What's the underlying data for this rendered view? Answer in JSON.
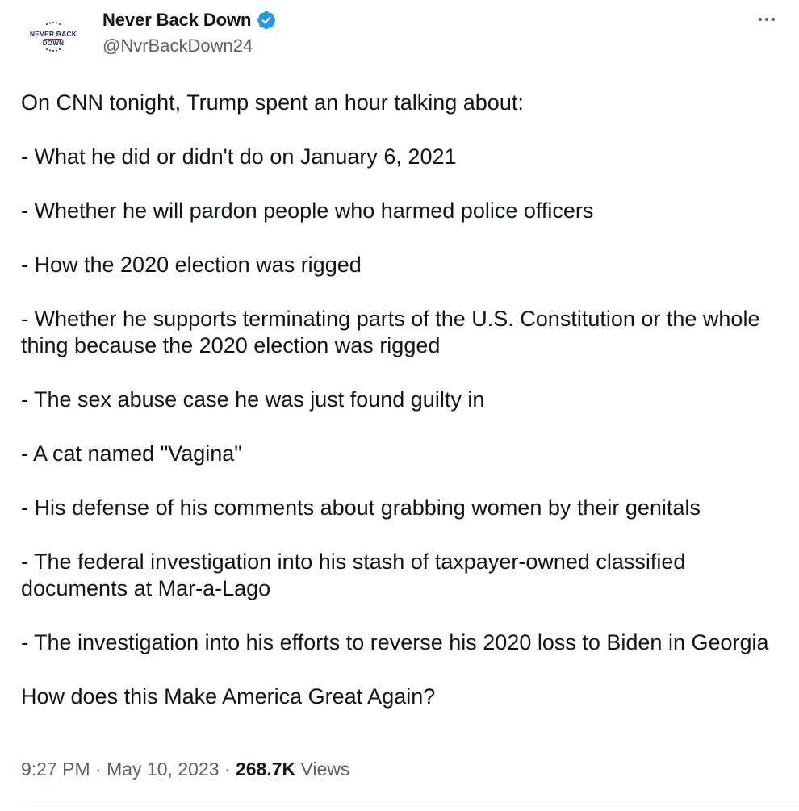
{
  "author": {
    "display_name": "Never Back Down",
    "handle": "@NvrBackDown24",
    "avatar_text": "NEVER BACK DOWN",
    "verified": true
  },
  "tweet": {
    "paragraphs": [
      "On CNN tonight, Trump spent an hour talking about:",
      "- What he did or didn't do on January 6, 2021",
      "- Whether he will pardon people who harmed police officers",
      "- How the 2020 election was rigged",
      "- Whether he supports terminating parts of the U.S. Constitution or the whole thing because the 2020 election was rigged",
      "- The sex abuse case he was just found guilty in",
      "- A cat named \"Vagina\"",
      "- His defense of his comments about grabbing women by their genitals",
      "- The federal investigation into his stash of taxpayer-owned classified documents at Mar-a-Lago",
      "- The investigation into his efforts to reverse his 2020 loss to Biden in Georgia",
      "How does this Make America Great Again?"
    ]
  },
  "meta": {
    "time": "9:27 PM",
    "separator": " · ",
    "date": "May 10, 2023",
    "views_count": "268.7K",
    "views_label": " Views"
  },
  "colors": {
    "verified_blue": "#1d9bf0",
    "text_primary": "#0f1419",
    "text_secondary": "#536471",
    "avatar_navy": "#1a2a5e",
    "avatar_red": "#c8102e"
  },
  "icons": {
    "verified": "verified-badge-icon",
    "more": "more-horizontal-icon"
  }
}
